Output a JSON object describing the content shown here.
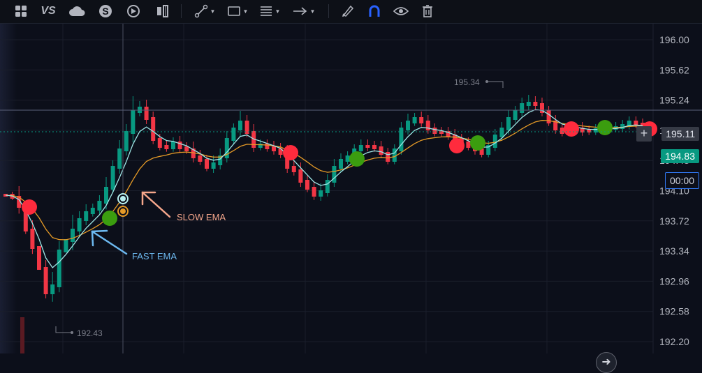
{
  "toolbar": {
    "left_icons": [
      "layout-grid-icon",
      "vs-compare-icon",
      "cloud-icon",
      "dollar-coin-icon",
      "replay-icon",
      "indicator-templates-icon"
    ],
    "vs_label": "VS",
    "drawing_tools": [
      "trend-line-icon",
      "rectangle-icon",
      "fib-lines-icon",
      "arrow-icon"
    ],
    "right_icons": [
      "brush-icon",
      "magnet-icon",
      "eye-icon",
      "trash-icon"
    ]
  },
  "price_axis": {
    "ticks": [
      "196.00",
      "195.62",
      "195.24",
      "194.86",
      "194.48",
      "194.10",
      "193.72",
      "193.34",
      "192.96",
      "192.58",
      "192.20"
    ],
    "current_price": "195.11",
    "last_price": "194.83",
    "countdown": "00:00",
    "plus_label": "+"
  },
  "annotations": {
    "high_label": "195.34",
    "low_label": "192.43",
    "slow_ema": "SLOW EMA",
    "fast_ema": "FAST EMA"
  },
  "colors": {
    "up": "#089981",
    "down": "#f23645",
    "fast_ema": "#9fe6e6",
    "slow_ema": "#e59a27",
    "buy_marker": "#3b9d0f",
    "sell_marker": "#ff2b3d",
    "background": "#0c0f1a"
  }
}
